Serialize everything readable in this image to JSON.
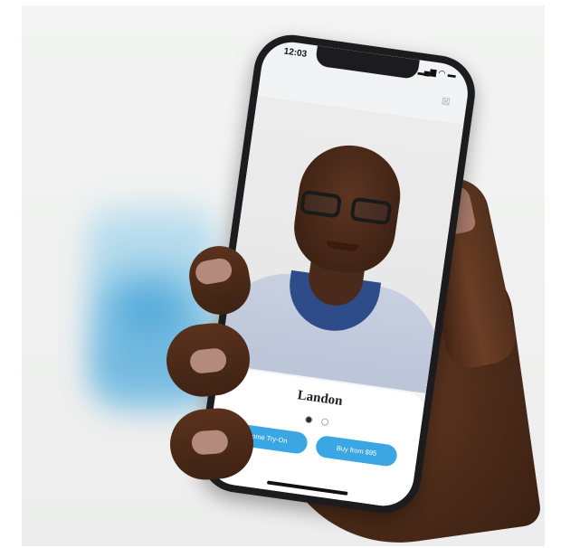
{
  "status_bar": {
    "time": "12:03",
    "icons": "▂▄▆ ◠ ▬"
  },
  "close_glyph": "⊠",
  "product": {
    "name": "Landon",
    "swatches": [
      "#2b2b2b",
      "#ffffff"
    ]
  },
  "actions": {
    "home_try_on": "+ Home Try-On",
    "buy": "Buy from $95"
  },
  "colors": {
    "accent": "#3aa6e4",
    "phone_frame": "#1c1c1e"
  }
}
